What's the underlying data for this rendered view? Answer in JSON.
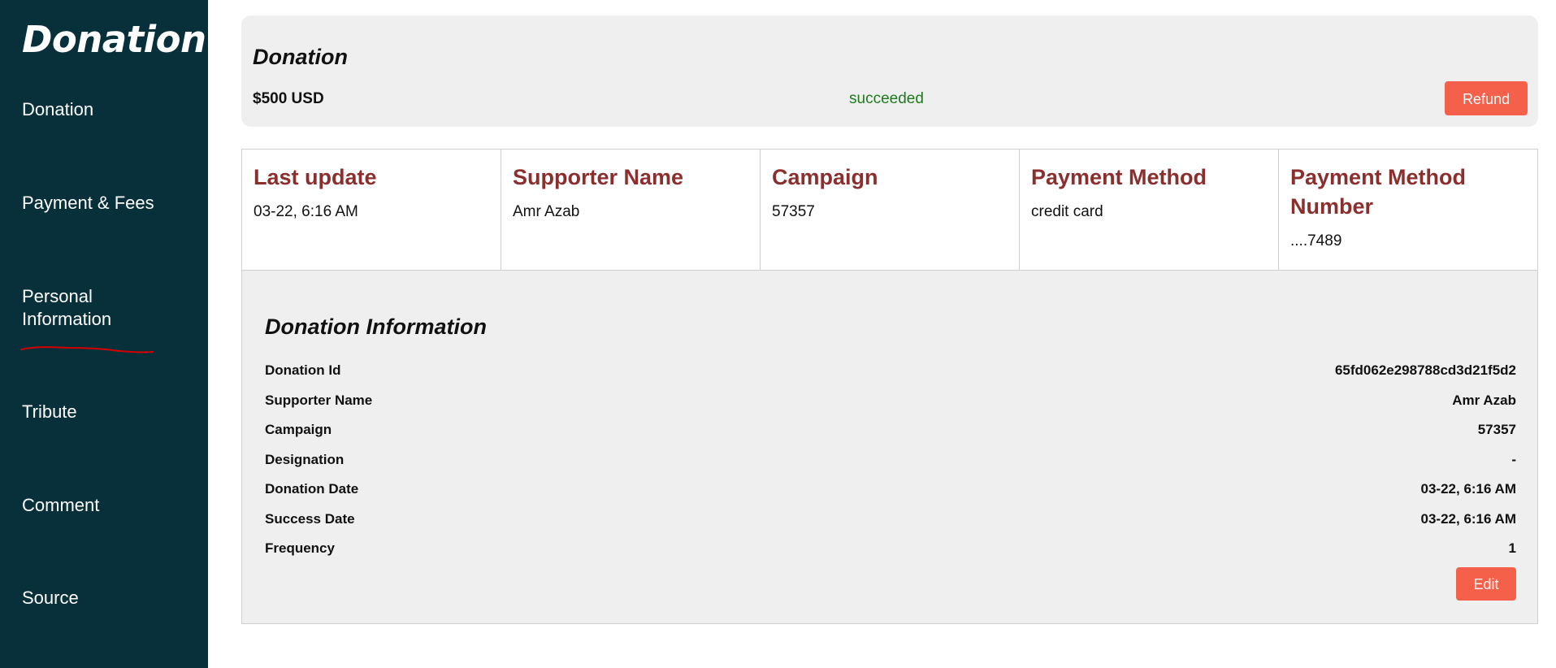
{
  "sidebar": {
    "brand": "Donation",
    "items": [
      {
        "label": "Donation"
      },
      {
        "label": "Payment & Fees"
      },
      {
        "label": "Personal Information"
      },
      {
        "label": "Tribute"
      },
      {
        "label": "Comment"
      },
      {
        "label": "Source"
      }
    ]
  },
  "summary": {
    "title": "Donation",
    "amount": "$500 USD",
    "status": "succeeded",
    "refund_label": "Refund"
  },
  "cards": [
    {
      "title": "Last update",
      "value": "03-22, 6:16 AM"
    },
    {
      "title": "Supporter Name",
      "value": "Amr Azab"
    },
    {
      "title": "Campaign",
      "value": "57357"
    },
    {
      "title": "Payment Method",
      "value": "credit card"
    },
    {
      "title": "Payment Method Number",
      "value": "....7489"
    }
  ],
  "info": {
    "title": "Donation Information",
    "rows": [
      {
        "label": "Donation Id",
        "value": "65fd062e298788cd3d21f5d2"
      },
      {
        "label": "Supporter Name",
        "value": "Amr Azab"
      },
      {
        "label": "Campaign",
        "value": "57357"
      },
      {
        "label": "Designation",
        "value": "-"
      },
      {
        "label": "Donation Date",
        "value": "03-22, 6:16 AM"
      },
      {
        "label": "Success Date",
        "value": "03-22, 6:16 AM"
      },
      {
        "label": "Frequency",
        "value": "1"
      }
    ],
    "edit_label": "Edit"
  },
  "colors": {
    "sidebar_bg": "#08303a",
    "accent_button": "#f5604a",
    "card_title": "#8b2e2e",
    "status_success": "#1f7a1f",
    "annotation_mark": "#d40000"
  }
}
